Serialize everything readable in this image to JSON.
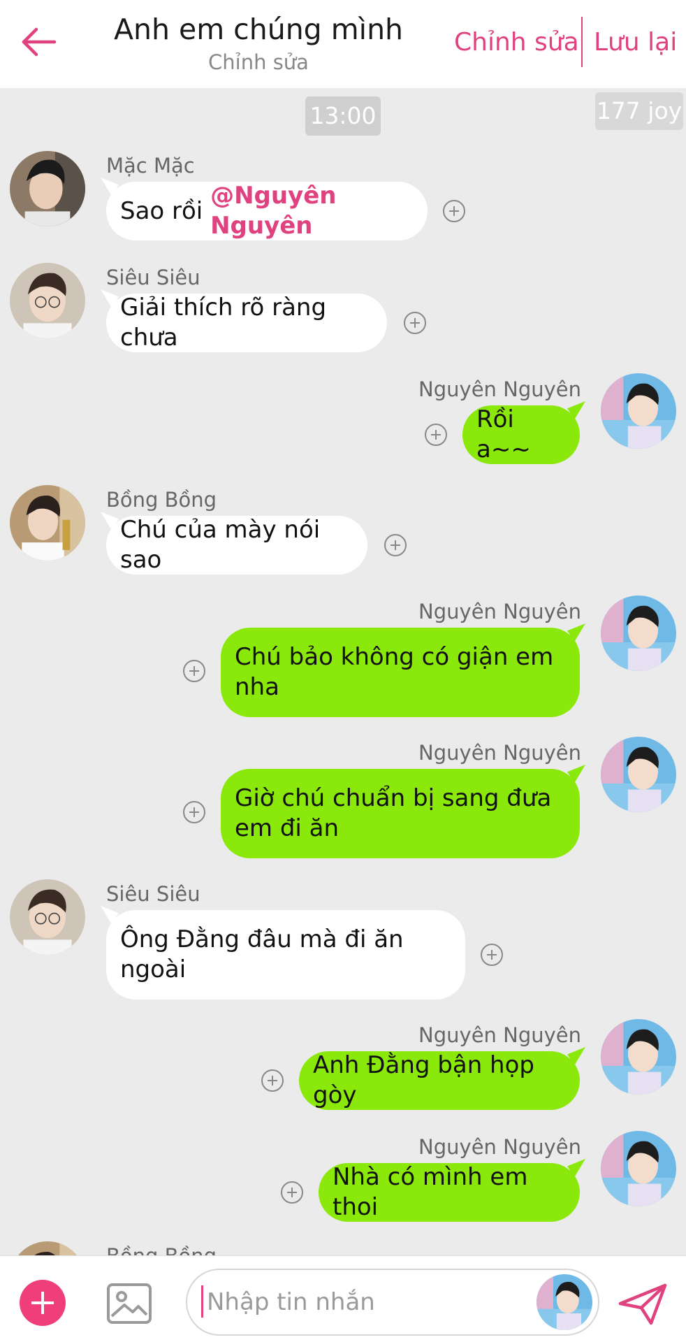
{
  "header": {
    "title": "Anh em chúng mình",
    "subtitle": "Chỉnh sửa",
    "edit_label": "Chỉnh sửa",
    "save_label": "Lưu lại",
    "accent_color": "#e0417f"
  },
  "chat": {
    "time": "13:00",
    "joy": "177 joy",
    "messages": [
      {
        "side": "left",
        "sender": "Mặc Mặc",
        "text_prefix": "Sao rồi ",
        "mention": "@Nguyên Nguyên"
      },
      {
        "side": "left",
        "sender": "Siêu Siêu",
        "text": "Giải thích rõ ràng chưa"
      },
      {
        "side": "right",
        "sender": "Nguyên Nguyên",
        "text": "Rồi a~~"
      },
      {
        "side": "left",
        "sender": "Bồng Bồng",
        "text": "Chú của mày nói sao"
      },
      {
        "side": "right",
        "sender": "Nguyên Nguyên",
        "text": "Chú bảo không có giận em nha"
      },
      {
        "side": "right",
        "sender": "Nguyên Nguyên",
        "text": "Giờ chú chuẩn bị sang đưa em đi ăn"
      },
      {
        "side": "left",
        "sender": "Siêu Siêu",
        "text": "Ông Đằng đâu mà đi ăn ngoài"
      },
      {
        "side": "right",
        "sender": "Nguyên Nguyên",
        "text": "Anh Đằng bận họp gòy"
      },
      {
        "side": "right",
        "sender": "Nguyên Nguyên",
        "text": "Nhà có mình em thoi"
      },
      {
        "side": "left",
        "sender": "Bồng Bồng",
        "text": ""
      }
    ]
  },
  "composer": {
    "placeholder": "Nhập tin nhắn"
  },
  "colors": {
    "right_bubble": "#8ae80b",
    "left_bubble": "#ffffff",
    "background": "#ebebeb",
    "add_button": "#ef3e7a"
  },
  "icons": [
    "back-arrow-icon",
    "plus-circle-icon",
    "image-icon",
    "send-icon",
    "add-icon"
  ]
}
